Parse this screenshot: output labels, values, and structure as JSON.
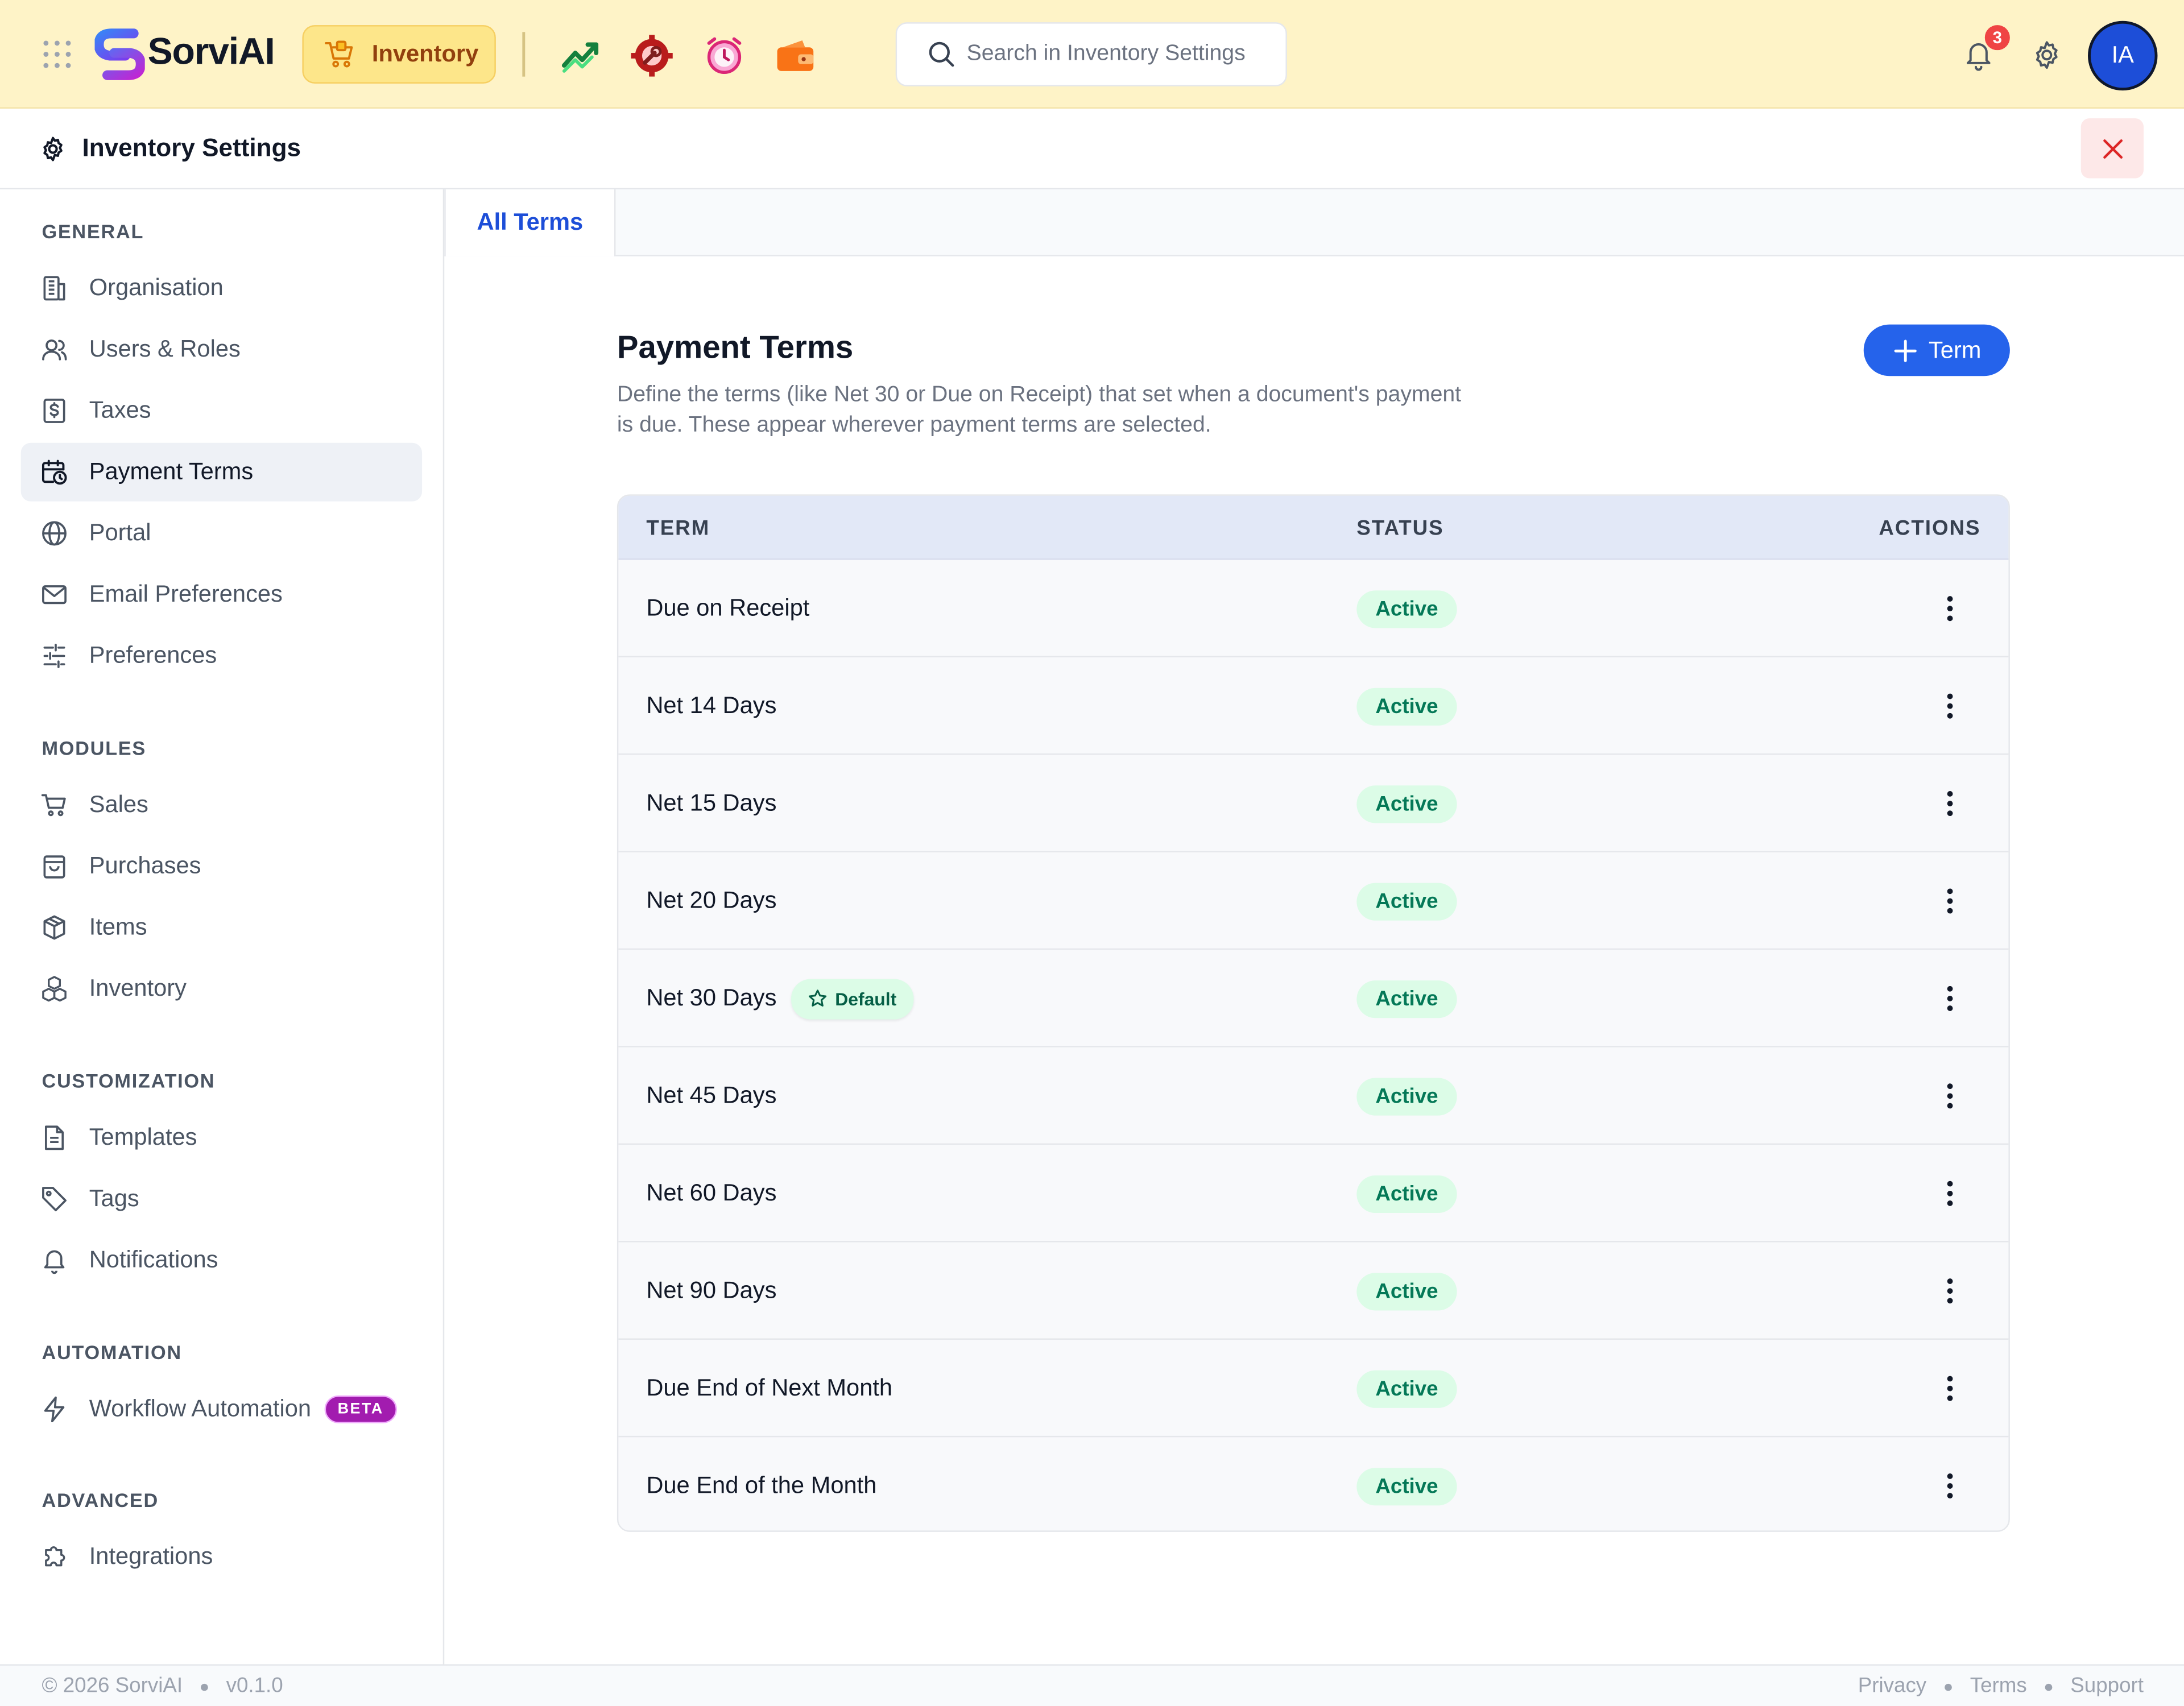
{
  "app": {
    "brand": "SorviAI",
    "module_label": "Inventory",
    "search_placeholder": "Search in Inventory Settings",
    "notification_count": "3",
    "user_initials": "IA",
    "header_bg": "#fef3c7",
    "accent": "#2563eb"
  },
  "app_icons": [
    "trend-chart-icon",
    "gear-wrench-icon",
    "alarm-clock-icon",
    "wallet-icon"
  ],
  "settings": {
    "title": "Inventory Settings"
  },
  "sidebar": {
    "general_label": "GENERAL",
    "general": [
      {
        "label": "Organisation",
        "icon": "building-icon"
      },
      {
        "label": "Users & Roles",
        "icon": "users-icon"
      },
      {
        "label": "Taxes",
        "icon": "tax-receipt-icon"
      },
      {
        "label": "Payment Terms",
        "icon": "calendar-clock-icon",
        "active": true
      },
      {
        "label": "Portal",
        "icon": "globe-icon"
      },
      {
        "label": "Email Preferences",
        "icon": "mail-icon"
      },
      {
        "label": "Preferences",
        "icon": "sliders-icon"
      }
    ],
    "modules_label": "MODULES",
    "modules": [
      {
        "label": "Sales",
        "icon": "cart-icon"
      },
      {
        "label": "Purchases",
        "icon": "bag-icon"
      },
      {
        "label": "Items",
        "icon": "box-icon"
      },
      {
        "label": "Inventory",
        "icon": "boxes-icon"
      }
    ],
    "customization_label": "CUSTOMIZATION",
    "customization": [
      {
        "label": "Templates",
        "icon": "document-icon"
      },
      {
        "label": "Tags",
        "icon": "tag-icon"
      },
      {
        "label": "Notifications",
        "icon": "bell-icon"
      }
    ],
    "automation_label": "AUTOMATION",
    "automation": [
      {
        "label": "Workflow Automation",
        "icon": "lightning-icon",
        "badge": "BETA"
      }
    ],
    "advanced_label": "ADVANCED",
    "advanced": [
      {
        "label": "Integrations",
        "icon": "puzzle-icon"
      }
    ]
  },
  "tabs": [
    {
      "label": "All Terms",
      "active": true
    }
  ],
  "main": {
    "title": "Payment Terms",
    "description": "Define the terms (like Net 30 or Due on Receipt) that set when a document's payment is due. These appear wherever payment terms are selected.",
    "add_button": "Term"
  },
  "table": {
    "headers": {
      "term": "TERM",
      "status": "STATUS",
      "actions": "ACTIONS"
    },
    "default_label": "Default",
    "rows": [
      {
        "term": "Due on Receipt",
        "status": "Active"
      },
      {
        "term": "Net 14 Days",
        "status": "Active"
      },
      {
        "term": "Net 15 Days",
        "status": "Active"
      },
      {
        "term": "Net 20 Days",
        "status": "Active"
      },
      {
        "term": "Net 30 Days",
        "status": "Active",
        "default": true
      },
      {
        "term": "Net 45 Days",
        "status": "Active"
      },
      {
        "term": "Net 60 Days",
        "status": "Active"
      },
      {
        "term": "Net 90 Days",
        "status": "Active"
      },
      {
        "term": "Due End of Next Month",
        "status": "Active"
      },
      {
        "term": "Due End of the Month",
        "status": "Active"
      }
    ]
  },
  "footer": {
    "copyright": "© 2026 SorviAI",
    "version": "v0.1.0",
    "links": [
      "Privacy",
      "Terms",
      "Support"
    ]
  }
}
